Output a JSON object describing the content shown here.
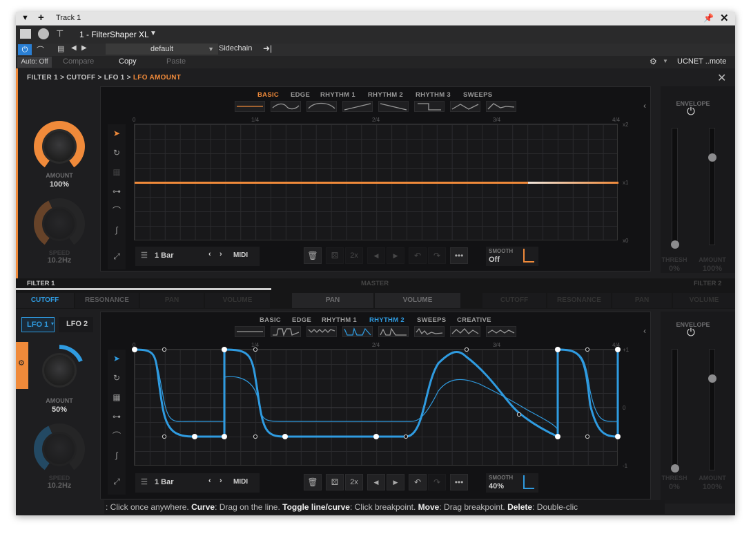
{
  "host": {
    "track_title": "Track 1",
    "plugin_slot": "1 - FilterShaper XL",
    "preset": "default",
    "sidechain_label": "Sidechain",
    "auto_label": "Auto: Off",
    "compare_label": "Compare",
    "copy_label": "Copy",
    "paste_label": "Paste",
    "remote_label": "UCNET ..mote"
  },
  "breadcrumb": {
    "path": "FILTER 1 > CUTOFF > LFO 1 > ",
    "current": "LFO AMOUNT"
  },
  "top_editor": {
    "shape_tabs": [
      "BASIC",
      "EDGE",
      "RHYTHM 1",
      "RHYTHM 2",
      "RHYTHM 3",
      "SWEEPS"
    ],
    "active_tab": "BASIC",
    "x_ticks": [
      "0",
      "1/4",
      "2/4",
      "3/4",
      "4/4"
    ],
    "y_ticks": [
      "x2",
      "x1",
      "x0"
    ],
    "length": "1 Bar",
    "midi": "MIDI",
    "double": "2x",
    "smooth_label": "SMOOTH",
    "smooth_value": "Off",
    "amount_label": "AMOUNT",
    "amount_value": "100%",
    "amount_level": 1.0,
    "speed_label": "SPEED",
    "speed_value": "10.2Hz",
    "envelope_label": "ENVELOPE",
    "thresh_label": "THRESH",
    "thresh_value": "0%",
    "env_amount_label": "AMOUNT",
    "env_amount_value": "100%",
    "accent": "#f08a3a"
  },
  "section_tabs": {
    "filter1_label": "FILTER 1",
    "master_label": "MASTER",
    "filter2_label": "FILTER 2",
    "filter1_tabs": [
      "CUTOFF",
      "RESONANCE",
      "PAN",
      "VOLUME"
    ],
    "master_tabs": [
      "PAN",
      "VOLUME"
    ],
    "filter2_tabs": [
      "CUTOFF",
      "RESONANCE",
      "PAN",
      "VOLUME"
    ],
    "active": "CUTOFF"
  },
  "bottom_editor": {
    "lfo_tabs": [
      "LFO 1",
      "LFO 2"
    ],
    "active_lfo": "LFO 1",
    "shape_tabs": [
      "BASIC",
      "EDGE",
      "RHYTHM 1",
      "RHYTHM 2",
      "SWEEPS",
      "CREATIVE"
    ],
    "active_tab": "RHYTHM 2",
    "x_ticks": [
      "0",
      "1/4",
      "2/4",
      "3/4",
      "4/4"
    ],
    "y_ticks": [
      "+1",
      "0",
      "-1"
    ],
    "length": "1 Bar",
    "midi": "MIDI",
    "double": "2x",
    "smooth_label": "SMOOTH",
    "smooth_value": "40%",
    "amount_label": "AMOUNT",
    "amount_value": "50%",
    "amount_level": 0.5,
    "speed_label": "SPEED",
    "speed_value": "10.2Hz",
    "envelope_label": "ENVELOPE",
    "thresh_label": "THRESH",
    "thresh_value": "0%",
    "env_amount_label": "AMOUNT",
    "env_amount_value": "100%",
    "accent": "#2f9be0"
  },
  "status_bar": {
    "segments": [
      {
        "bold": false,
        "text": ": Click once anywhere. "
      },
      {
        "bold": true,
        "text": "Curve"
      },
      {
        "bold": false,
        "text": ": Drag on the line. "
      },
      {
        "bold": true,
        "text": "Toggle line/curve"
      },
      {
        "bold": false,
        "text": ": Click breakpoint. "
      },
      {
        "bold": true,
        "text": "Move"
      },
      {
        "bold": false,
        "text": ": Drag breakpoint. "
      },
      {
        "bold": true,
        "text": "Delete"
      },
      {
        "bold": false,
        "text": ": Double-clic"
      }
    ]
  }
}
